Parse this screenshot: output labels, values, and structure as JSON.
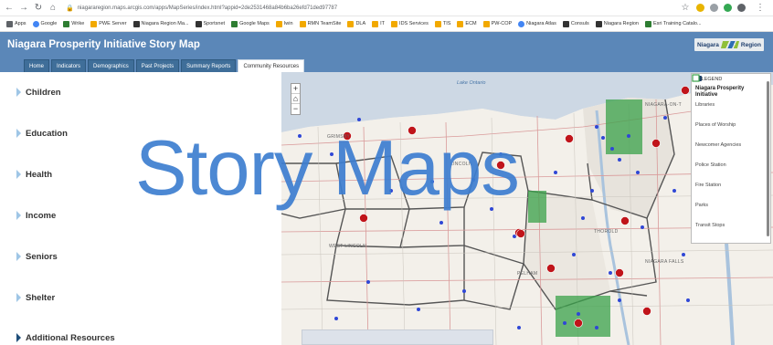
{
  "browser": {
    "url": "niagararegion.maps.arcgis.com/apps/MapSeries/index.html?appid=2de2531468a84b6ba26efd71ded97787",
    "bookmarks": [
      "Apps",
      "Google",
      "Wrike",
      "PWE Server",
      "Niagara Region Ma...",
      "Sportsnet",
      "Google Maps",
      "Iwin",
      "RMN TeamSite",
      "DLA",
      "IT",
      "IDS Services",
      "TIS",
      "ECM",
      "PW-COP",
      "Niagara Atlas",
      "Consuls",
      "Niagara Region",
      "Esri Training Catalo..."
    ]
  },
  "app": {
    "title": "Niagara Prosperity Initiative Story Map",
    "logo_text_left": "Niagara",
    "logo_text_right": "Region"
  },
  "tabs": [
    {
      "label": "Home",
      "active": false
    },
    {
      "label": "Indicators",
      "active": false
    },
    {
      "label": "Demographics",
      "active": false
    },
    {
      "label": "Past Projects",
      "active": false
    },
    {
      "label": "Summary Reports",
      "active": false
    },
    {
      "label": "Community Resources",
      "active": true
    }
  ],
  "sidebar": {
    "items": [
      "Children",
      "Education",
      "Health",
      "Income",
      "Seniors",
      "Shelter",
      "Additional Resources"
    ]
  },
  "map": {
    "zoom_in": "+",
    "home": "⌂",
    "zoom_out": "−",
    "lake_label": "Lake Ontario",
    "place_labels": [
      "GRIMSBY",
      "LINCOLN",
      "WEST LINCOLN",
      "THOROLD",
      "PELHAM",
      "NIAGARA-ON-T",
      "NIAGARA FALLS"
    ]
  },
  "legend": {
    "header": "LEGEND",
    "group_title": "Niagara Prosperity Initiative",
    "items": [
      "Libraries",
      "Places of Worship",
      "Newcomer Agencies",
      "Police Station",
      "Fire Station",
      "Parks",
      "Transit Stops"
    ]
  },
  "watermark": "Story Maps",
  "colors": {
    "header_bg": "#5b87b8",
    "tab_bg": "#3f6e99",
    "accent_light": "#9fc6e6",
    "watermark": "#3d7ed0",
    "fire_red": "#c0141a",
    "worship_blue": "#2f47d6"
  }
}
